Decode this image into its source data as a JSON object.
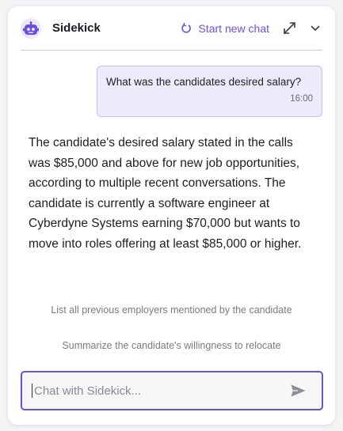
{
  "header": {
    "title": "Sidekick",
    "new_chat_label": "Start new chat",
    "logo_icon": "robot-icon",
    "new_chat_icon": "refresh-icon",
    "expand_icon": "expand-icon",
    "collapse_icon": "chevron-down-icon"
  },
  "colors": {
    "accent": "#6b4fe0",
    "bubble_bg": "#eeeafc",
    "bubble_border": "#c7bff1"
  },
  "messages": {
    "user": {
      "text": "What was the candidates desired salary?",
      "time": "16:00"
    },
    "assistant": {
      "text": "The candidate's desired salary stated in the calls was $85,000 and above for new job opportunities, according to multiple recent conversations. The candidate is currently a software engineer at Cyberdyne Systems earning $70,000 but wants to move into roles offering at least $85,000 or higher."
    }
  },
  "suggestions": [
    "List all previous employers mentioned by the candidate",
    "Summarize the candidate's willingness to relocate"
  ],
  "input": {
    "placeholder": "Chat with Sidekick...",
    "value": "",
    "send_icon": "send-icon"
  }
}
